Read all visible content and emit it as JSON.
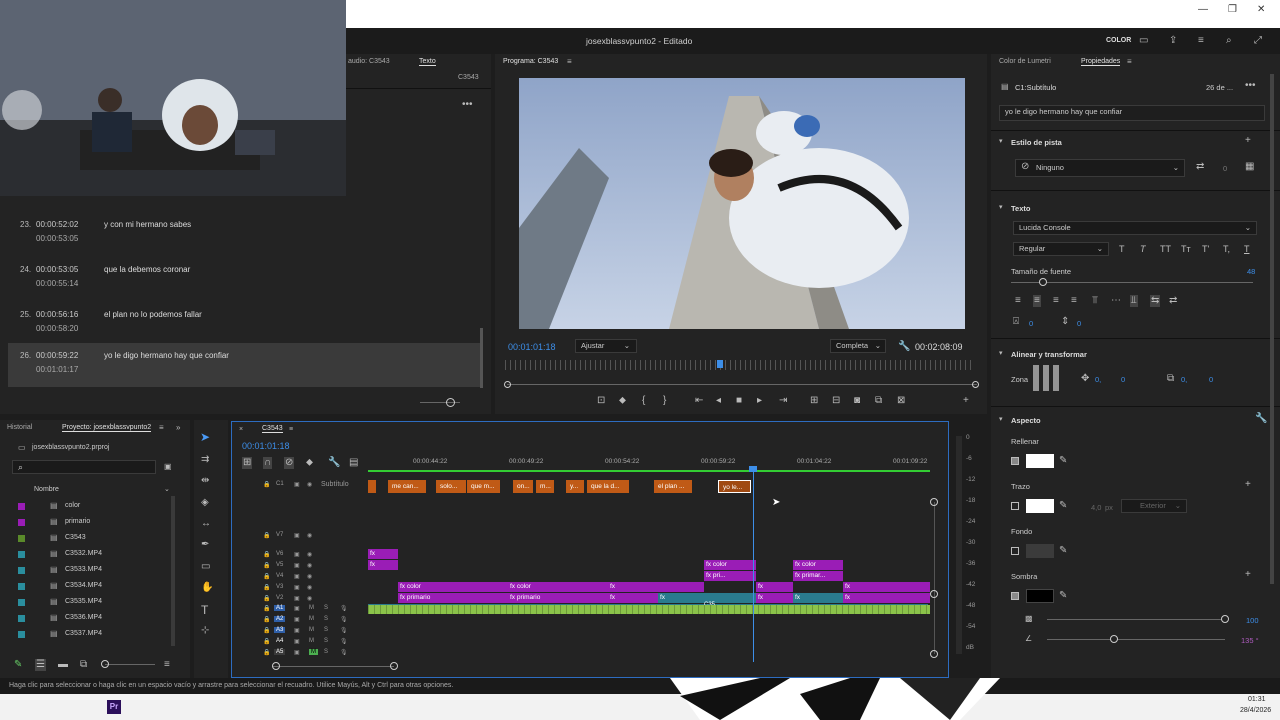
{
  "window": {
    "title": "josexblassvpunto2 - Editado",
    "color_label": "COLOR"
  },
  "text_panel": {
    "tab_audio": "audio: C3543",
    "tab_text": "Texto",
    "seq": "C3543"
  },
  "captions": [
    {
      "num": "23.",
      "start": "00:00:52:02",
      "end": "00:00:53:05",
      "text": "y con mi hermano sabes"
    },
    {
      "num": "24.",
      "start": "00:00:53:05",
      "end": "00:00:55:14",
      "text": "que la debemos coronar"
    },
    {
      "num": "25.",
      "start": "00:00:56:16",
      "end": "00:00:58:20",
      "text": "el plan no lo podemos fallar"
    },
    {
      "num": "26.",
      "start": "00:00:59:22",
      "end": "00:01:01:17",
      "text": "yo le digo hermano hay que confiar"
    }
  ],
  "program": {
    "tab": "Programa: C3543",
    "timecode": "00:01:01:18",
    "fit": "Ajustar",
    "quality": "Completa",
    "duration": "00:02:08:09",
    "playhead_fraction": 0.45
  },
  "properties": {
    "tab_lumetri": "Color de Lumetri",
    "tab_props": "Propiedades",
    "caption_name": "C1:Subtítulo",
    "date": "26 de ...",
    "caption_text": "yo le digo hermano hay que confiar",
    "track_style_section": "Estilo de pista",
    "track_style": "Ninguno",
    "track_style_count": "0",
    "text_section": "Texto",
    "font": "Lucida Console",
    "font_style": "Regular",
    "font_size_label": "Tamaño de fuente",
    "font_size": "48",
    "tracking": "0",
    "leading": "0",
    "align_section": "Alinear y transformar",
    "zone_label": "Zona",
    "pos_x": "0,",
    "pos_y": "0",
    "scale_x": "0,",
    "scale_y": "0",
    "appearance_section": "Aspecto",
    "fill_label": "Rellenar",
    "fill_color": "#ffffff",
    "stroke_label": "Trazo",
    "stroke_color": "#ffffff",
    "stroke_width": "4,0",
    "stroke_unit": "px",
    "stroke_pos": "Exterior",
    "bg_label": "Fondo",
    "bg_color": "#3b3b3b",
    "shadow_label": "Sombra",
    "shadow_color": "#000000",
    "shadow_opacity": "100",
    "shadow_angle": "135 °"
  },
  "project": {
    "tab_history": "Historial",
    "tab_project": "Proyecto: josexblassvpunto2",
    "file": "josexblassvpunto2.prproj",
    "col_name": "Nombre",
    "items": [
      {
        "name": "color",
        "swatch": "#9a1db6"
      },
      {
        "name": "primario",
        "swatch": "#9a1db6"
      },
      {
        "name": "C3543",
        "swatch": "#5a8a2a"
      },
      {
        "name": "C3532.MP4",
        "swatch": "#2a8e9e"
      },
      {
        "name": "C3533.MP4",
        "swatch": "#2a8e9e"
      },
      {
        "name": "C3534.MP4",
        "swatch": "#2a8e9e"
      },
      {
        "name": "C3535.MP4",
        "swatch": "#2a8e9e"
      },
      {
        "name": "C3536.MP4",
        "swatch": "#2a8e9e"
      },
      {
        "name": "C3537.MP4",
        "swatch": "#2a8e9e"
      }
    ]
  },
  "timeline": {
    "tab": "C3543",
    "timecode": "00:01:01:18",
    "ruler": [
      "00:00:44:22",
      "00:00:49:22",
      "00:00:54:22",
      "00:00:59:22",
      "00:01:04:22",
      "00:01:09:22"
    ],
    "subtitle_track": "Subtítulo",
    "c1": "C1",
    "video_tracks": [
      "V7",
      "V6",
      "V5",
      "V4",
      "V3",
      "V2"
    ],
    "audio_tracks": [
      "A1",
      "A2",
      "A3",
      "A4",
      "A5"
    ],
    "subtitle_clips": [
      "me can...",
      "solo...",
      "que m...",
      "on...",
      "m...",
      "y...",
      "que la d...",
      "el plan ...",
      "yo le..."
    ],
    "clip_labels": {
      "color": "color",
      "primario": "primario",
      "pri": "pri...",
      "primar": "primar...",
      "c35": "C35"
    }
  },
  "meters": [
    "0",
    "-6",
    "-12",
    "-18",
    "-24",
    "-30",
    "-36",
    "-42",
    "-48",
    "-54",
    "dB"
  ],
  "status": "Haga clic para seleccionar o haga clic en un espacio vacío y arrastre para seleccionar el recuadro. Utilice Mayús, Alt y Ctrl para otras opciones.",
  "taskbar": {
    "time": "01:31",
    "date": "28/4/2026",
    "app": "Pr"
  }
}
